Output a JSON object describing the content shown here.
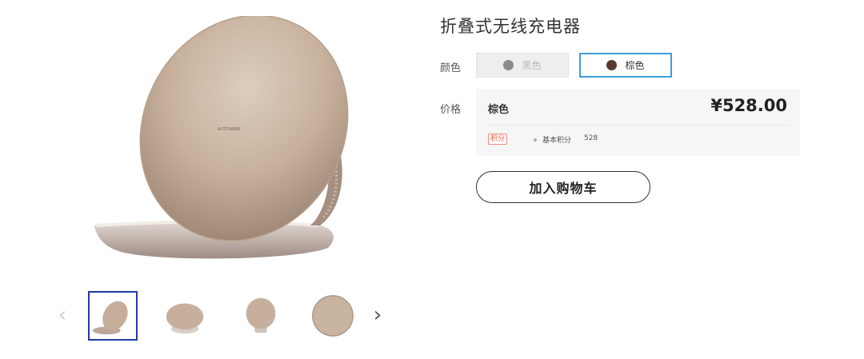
{
  "product": {
    "title": "折叠式无线充电器",
    "image_brand_text": "AUTOWARE"
  },
  "color": {
    "label": "颜色",
    "options": [
      {
        "name": "黑色",
        "swatch": "#8c8c8c",
        "state": "disabled"
      },
      {
        "name": "棕色",
        "swatch": "#5a3a2e",
        "state": "selected"
      }
    ],
    "selected_border": "#3c9ed8"
  },
  "price": {
    "label": "价格",
    "variant": "棕色",
    "value": "¥528.00",
    "points_badge": "积分",
    "points_text": "基本积分",
    "points_value": "528"
  },
  "cart": {
    "label": "加入购物车"
  },
  "gallery": {
    "prev_icon": "chevron-left-icon",
    "next_icon": "chevron-right-icon",
    "prev_glyph": "‹",
    "next_glyph": "›",
    "thumbnail_count": 4,
    "active_thumbnail": 1,
    "active_border": "#1f3aa8"
  }
}
